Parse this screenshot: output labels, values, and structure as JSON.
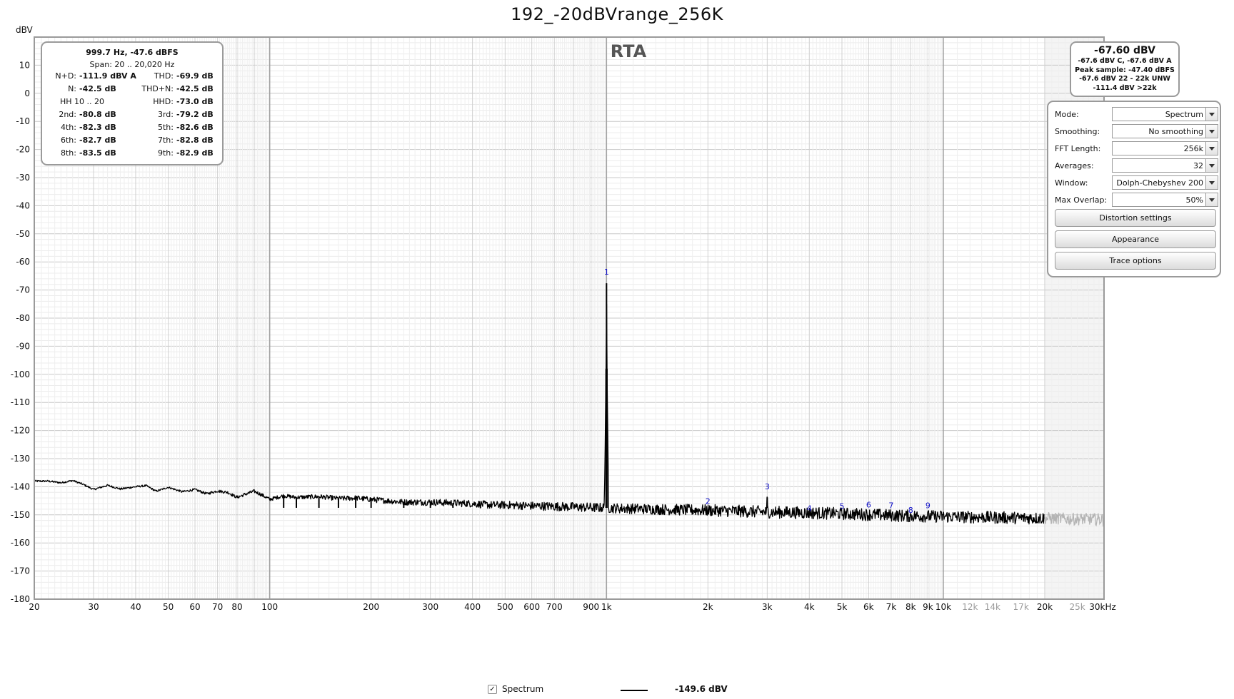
{
  "title": "192_-20dBVrange_256K",
  "chart_data": {
    "type": "line",
    "title": "RTA",
    "ylabel": "dBV",
    "xunit_label": "30kHz",
    "xscale": "log",
    "xlim": [
      20,
      30000
    ],
    "ylim": [
      -180,
      20
    ],
    "grid": true,
    "y_ticks": [
      10,
      0,
      -10,
      -20,
      -30,
      -40,
      -50,
      -60,
      -70,
      -80,
      -90,
      -100,
      -110,
      -120,
      -130,
      -140,
      -150,
      -160,
      -170,
      -180
    ],
    "x_ticks": [
      {
        "v": 20,
        "label": "20"
      },
      {
        "v": 30,
        "label": "30"
      },
      {
        "v": 40,
        "label": "40"
      },
      {
        "v": 50,
        "label": "50"
      },
      {
        "v": 60,
        "label": "60"
      },
      {
        "v": 70,
        "label": "70"
      },
      {
        "v": 80,
        "label": "80"
      },
      {
        "v": 100,
        "label": "100"
      },
      {
        "v": 200,
        "label": "200"
      },
      {
        "v": 300,
        "label": "300"
      },
      {
        "v": 400,
        "label": "400"
      },
      {
        "v": 500,
        "label": "500"
      },
      {
        "v": 600,
        "label": "600"
      },
      {
        "v": 700,
        "label": "700"
      },
      {
        "v": 900,
        "label": "900"
      },
      {
        "v": 1000,
        "label": "1k"
      },
      {
        "v": 2000,
        "label": "2k"
      },
      {
        "v": 3000,
        "label": "3k"
      },
      {
        "v": 4000,
        "label": "4k"
      },
      {
        "v": 5000,
        "label": "5k"
      },
      {
        "v": 6000,
        "label": "6k"
      },
      {
        "v": 7000,
        "label": "7k"
      },
      {
        "v": 8000,
        "label": "8k"
      },
      {
        "v": 9000,
        "label": "9k"
      },
      {
        "v": 10000,
        "label": "10k"
      },
      {
        "v": 12000,
        "label": "12k"
      },
      {
        "v": 14000,
        "label": "14k"
      },
      {
        "v": 17000,
        "label": "17k"
      },
      {
        "v": 20000,
        "label": "20k"
      },
      {
        "v": 25000,
        "label": "25k"
      }
    ],
    "series": [
      {
        "name": "Spectrum",
        "legend_value": "-149.6 dBV",
        "color": "#000000",
        "out_of_band_color": "#b4b4b4",
        "points": [
          [
            20,
            -138.0
          ],
          [
            22,
            -138.0
          ],
          [
            24,
            -138.6
          ],
          [
            26,
            -137.8
          ],
          [
            28,
            -139.2
          ],
          [
            30,
            -141.0
          ],
          [
            33,
            -139.5
          ],
          [
            36,
            -140.8
          ],
          [
            40,
            -140.0
          ],
          [
            43,
            -139.6
          ],
          [
            46,
            -141.6
          ],
          [
            50,
            -140.2
          ],
          [
            55,
            -141.8
          ],
          [
            60,
            -141.0
          ],
          [
            65,
            -142.5
          ],
          [
            70,
            -141.5
          ],
          [
            75,
            -142.0
          ],
          [
            80,
            -143.8
          ],
          [
            85,
            -142.6
          ],
          [
            90,
            -141.6
          ],
          [
            95,
            -143.0
          ],
          [
            100,
            -144.5
          ],
          [
            110,
            -143.2
          ],
          [
            120,
            -143.8
          ],
          [
            140,
            -143.5
          ],
          [
            160,
            -144.2
          ],
          [
            180,
            -144.0
          ],
          [
            200,
            -144.5
          ],
          [
            250,
            -145.5
          ],
          [
            300,
            -145.5
          ],
          [
            350,
            -145.8
          ],
          [
            400,
            -146.0
          ],
          [
            450,
            -146.5
          ],
          [
            500,
            -146.5
          ],
          [
            600,
            -146.8
          ],
          [
            700,
            -147.0
          ],
          [
            800,
            -147.2
          ],
          [
            900,
            -147.4
          ],
          [
            985,
            -147.5
          ],
          [
            997,
            -98.0
          ],
          [
            1000,
            -67.6
          ],
          [
            1003,
            -98.0
          ],
          [
            1015,
            -147.6
          ],
          [
            1200,
            -147.8
          ],
          [
            1500,
            -148.1
          ],
          [
            2000,
            -148.4
          ],
          [
            2500,
            -148.7
          ],
          [
            2990,
            -149.0
          ],
          [
            3000,
            -143.8
          ],
          [
            3010,
            -149.0
          ],
          [
            4000,
            -149.3
          ],
          [
            5000,
            -149.6
          ],
          [
            6000,
            -149.9
          ],
          [
            7000,
            -150.2
          ],
          [
            8000,
            -150.4
          ],
          [
            9000,
            -150.5
          ],
          [
            10000,
            -150.6
          ],
          [
            12000,
            -150.8
          ],
          [
            15000,
            -151.0
          ],
          [
            20000,
            -151.2
          ]
        ],
        "out_of_band": [
          [
            20000,
            -151.2
          ],
          [
            25000,
            -151.5
          ],
          [
            30000,
            -151.6
          ]
        ]
      }
    ],
    "harmonic_markers": [
      {
        "label": "1",
        "x": 1000,
        "y": -66.0
      },
      {
        "label": "2",
        "x": 2000,
        "y": -147.6
      },
      {
        "label": "3",
        "x": 3000,
        "y": -142.4
      },
      {
        "label": "4",
        "x": 4000,
        "y": -150.2
      },
      {
        "label": "5",
        "x": 5000,
        "y": -149.4
      },
      {
        "label": "6",
        "x": 6000,
        "y": -148.9
      },
      {
        "label": "7",
        "x": 7000,
        "y": -149.2
      },
      {
        "label": "8",
        "x": 8000,
        "y": -150.8
      },
      {
        "label": "9",
        "x": 9000,
        "y": -149.2
      }
    ]
  },
  "stats": {
    "line1": "999.7 Hz, -47.6 dBFS",
    "line2": "Span: 20 .. 20,020 Hz",
    "rows": [
      [
        "N+D:",
        "-111.9 dBV A",
        "THD:",
        "-69.9 dB"
      ],
      [
        "N:",
        "-42.5 dB",
        "THD+N:",
        "-42.5 dB"
      ],
      [
        "HH 10 .. 20",
        "",
        "HHD:",
        "-73.0 dB"
      ],
      [
        "2nd:",
        "-80.8 dB",
        "3rd:",
        "-79.2 dB"
      ],
      [
        "4th:",
        "-82.3 dB",
        "5th:",
        "-82.6 dB"
      ],
      [
        "6th:",
        "-82.7 dB",
        "7th:",
        "-82.8 dB"
      ],
      [
        "8th:",
        "-83.5 dB",
        "9th:",
        "-82.9 dB"
      ]
    ]
  },
  "level": {
    "main": "-67.60 dBV",
    "lines": [
      "-67.6 dBV C, -67.6 dBV A",
      "Peak sample: -47.40 dBFS",
      "-67.6 dBV 22 - 22k UNW",
      "-111.4 dBV >22k"
    ]
  },
  "controls": {
    "fields": [
      {
        "label": "Mode:",
        "value": "Spectrum"
      },
      {
        "label": "Smoothing:",
        "value": "No  smoothing"
      },
      {
        "label": "FFT Length:",
        "value": "256k"
      },
      {
        "label": "Averages:",
        "value": "32"
      },
      {
        "label": "Window:",
        "value": "Dolph-Chebyshev 200"
      },
      {
        "label": "Max Overlap:",
        "value": "50%"
      }
    ],
    "buttons": [
      "Distortion settings",
      "Appearance",
      "Trace options"
    ]
  },
  "legend": {
    "check": "✓",
    "name": "Spectrum",
    "value": "-149.6 dBV"
  }
}
